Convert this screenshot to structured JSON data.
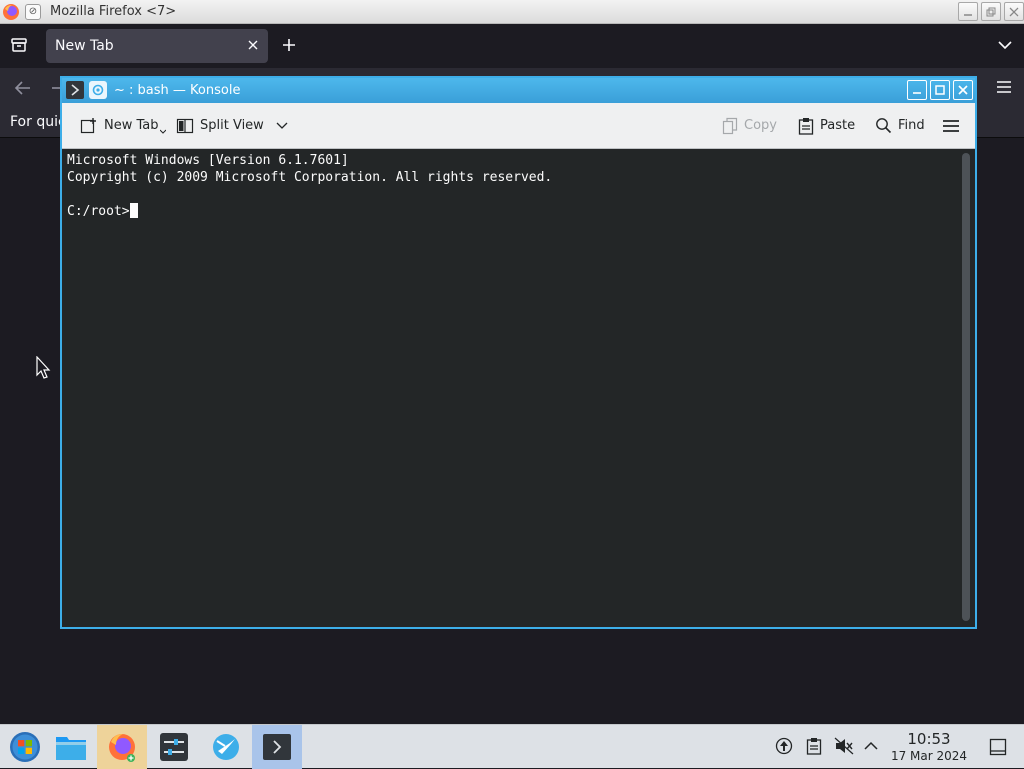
{
  "firefox": {
    "window_title": "Mozilla Firefox <7>",
    "tab": {
      "label": "New Tab"
    },
    "bookmarks_text": "For quic"
  },
  "konsole": {
    "title": "~ : bash — Konsole",
    "toolbar": {
      "new_tab": "New Tab",
      "split_view": "Split View",
      "copy": "Copy",
      "paste": "Paste",
      "find": "Find"
    },
    "terminal": {
      "line1": "Microsoft Windows [Version 6.1.7601]",
      "line2": "Copyright (c) 2009 Microsoft Corporation. All rights reserved.",
      "line3": "",
      "prompt": "C:/root>"
    }
  },
  "taskbar": {
    "items": [
      "start-menu",
      "file-manager",
      "firefox",
      "system-settings",
      "discover",
      "konsole"
    ],
    "clock": {
      "time": "10:53",
      "date": "17 Mar 2024"
    }
  },
  "colors": {
    "konsole_accent": "#3daee9",
    "terminal_bg": "#232627",
    "firefox_bg": "#1c1b22",
    "taskbar_bg": "#dde1e6"
  }
}
